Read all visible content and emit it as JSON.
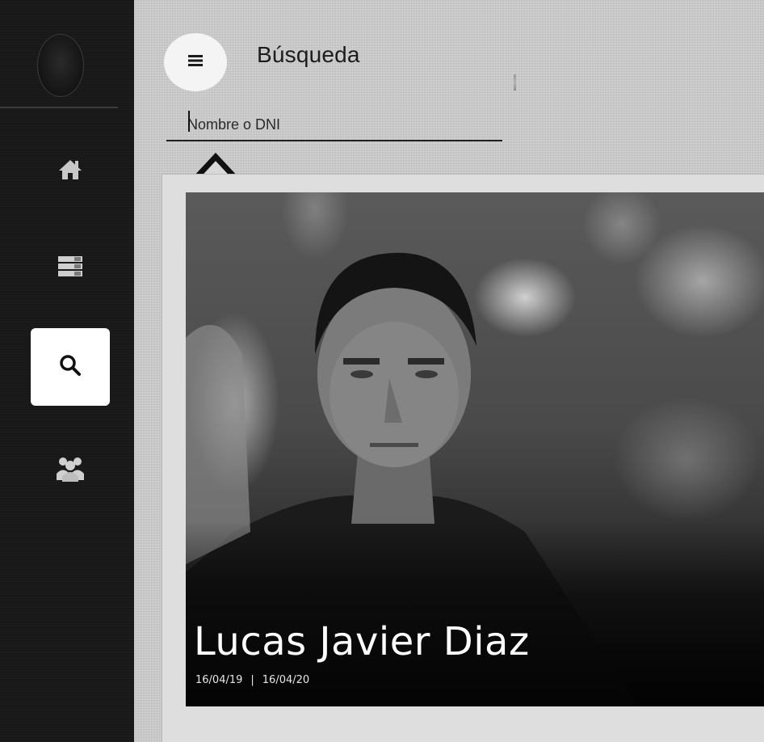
{
  "header": {
    "title": "Búsqueda",
    "menu_icon": "hamburger-menu-icon"
  },
  "search": {
    "placeholder": "Nombre o DNI",
    "value": ""
  },
  "sidebar": {
    "items": [
      {
        "id": "home",
        "icon": "home-icon",
        "active": false
      },
      {
        "id": "list",
        "icon": "list-icon",
        "active": false
      },
      {
        "id": "search",
        "icon": "search-icon",
        "active": true
      },
      {
        "id": "group",
        "icon": "group-icon",
        "active": false
      }
    ]
  },
  "annotation": {
    "icon": "arrow-up-icon"
  },
  "result_card": {
    "name": "Lucas Javier Diaz",
    "date_start": "16/04/19",
    "date_separator": "|",
    "date_end": "16/04/20"
  },
  "colors": {
    "sidebar_bg": "#151515",
    "page_bg": "#cfcfcf",
    "active_item_bg": "#ffffff",
    "icon_color": "#cfcfcf"
  }
}
